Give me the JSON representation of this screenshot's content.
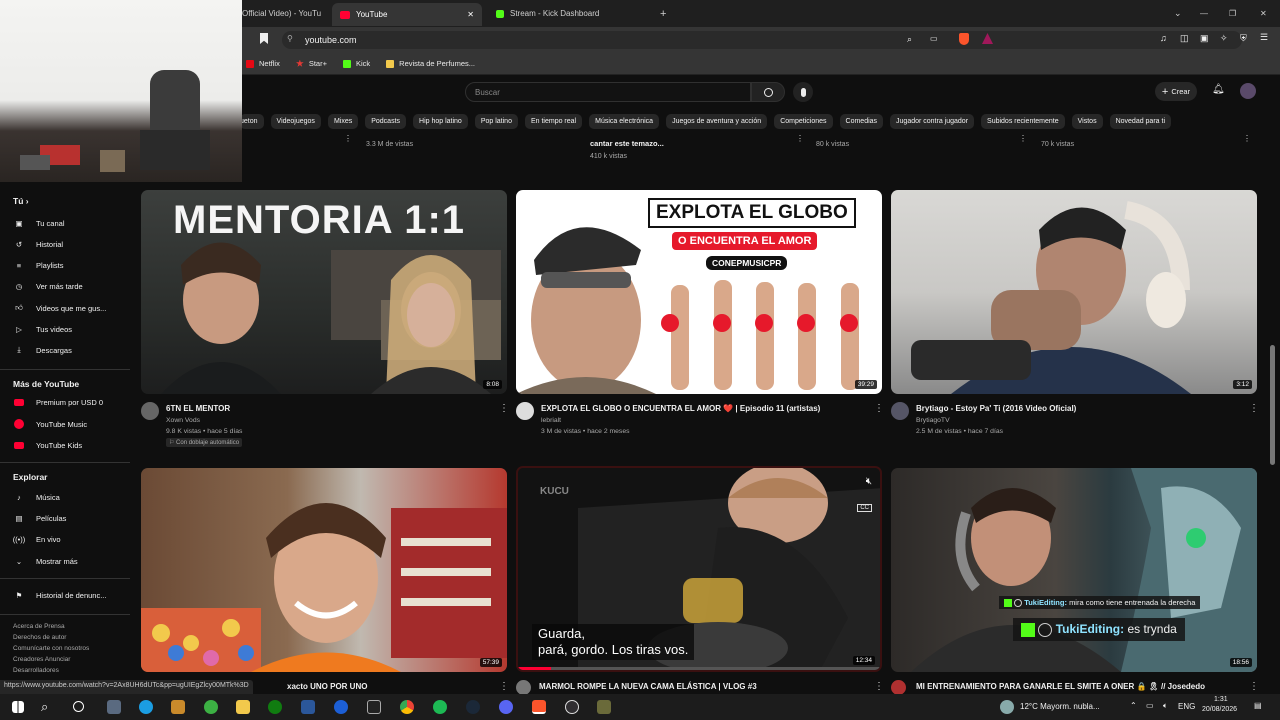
{
  "browser": {
    "tabs": [
      {
        "label": "Official Video) - YouTu",
        "active": false
      },
      {
        "label": "YouTube",
        "active": true
      },
      {
        "label": "Stream - Kick Dashboard",
        "active": false
      }
    ],
    "new_tab": "+",
    "address": "youtube.com",
    "bookmarks": [
      "Netflix",
      "Star+",
      "Kick",
      "Revista de Perfumes..."
    ]
  },
  "youtube": {
    "search_placeholder": "Buscar",
    "create_label": "Crear",
    "chips": [
      "ueton",
      "Videojuegos",
      "Mixes",
      "Podcasts",
      "Hip hop latino",
      "Pop latino",
      "En tiempo real",
      "Música electrónica",
      "Juegos de aventura y acción",
      "Competiciones",
      "Comedias",
      "Jugador contra jugador",
      "Subidos recientemente",
      "Vistos",
      "Novedad para ti"
    ],
    "sidebar": {
      "you_header": "Tú",
      "you_items": [
        "Tu canal",
        "Historial",
        "Playlists",
        "Ver más tarde",
        "Videos que me gus...",
        "Tus videos",
        "Descargas"
      ],
      "more_header": "Más de YouTube",
      "more_items": [
        "Premium por USD 0",
        "YouTube Music",
        "YouTube Kids"
      ],
      "explore_header": "Explorar",
      "explore_items": [
        "Música",
        "Películas",
        "En vivo",
        "Mostrar más"
      ],
      "report": "Historial de denunc...",
      "footer": [
        "Acerca de  Prensa",
        "Derechos de autor",
        "Comunícarte con nosotros",
        "Creadores  Anunciar",
        "Desarrolladores"
      ]
    },
    "previous_row": [
      {
        "meta": "3.3 M de vistas"
      },
      {
        "title": "cantar este temazo...",
        "meta": "410 k vistas"
      },
      {
        "meta": "80 k vistas"
      },
      {
        "meta": "70 k vistas"
      }
    ],
    "videos": [
      {
        "thumb_text": "MENTORIA 1:1",
        "duration": "8:08",
        "title": "6TN EL MENTOR",
        "channel": "Xown Vods",
        "meta": "9.8 K vistas • hace 5 días",
        "extra": "Con doblaje automático"
      },
      {
        "thumb_text": "EXPLOTA EL GLOBO",
        "thumb_sub": "O ENCUENTRA EL AMOR",
        "thumb_tag": "CONEPMUSICPR",
        "duration": "39:29",
        "title": "EXPLOTA EL GLOBO O ENCUENTRA EL AMOR ❤️ | Episodio 11 (artistas)",
        "channel": "lebrialt",
        "meta": "3 M de vistas • hace 2 meses"
      },
      {
        "duration": "3:12",
        "title": "Brytiago - Estoy Pa' Ti (2016 Video Oficial)",
        "channel": "BrytiagoTV",
        "meta": "2.5 M de vistas • hace 7 días"
      },
      {
        "duration": "57:39",
        "title": "xacto UNO POR UNO",
        "channel": "",
        "meta": ""
      },
      {
        "subtitle_line1": "Guarda,",
        "subtitle_line2": "pará, gordo. Los tiras vos.",
        "duration": "12:34",
        "title": "MARMOL ROMPE LA NUEVA CAMA ELÁSTICA | VLOG #3",
        "channel": "",
        "meta": ""
      },
      {
        "chat1_user": "TukiEditing:",
        "chat1_msg": "mira como tiene entrenada la derecha",
        "chat2_user": "TukiEditing:",
        "chat2_msg": "es trynda",
        "duration": "18:56",
        "title": "MI ENTRENAMIENTO PARA GANARLE EL SMITE A ONER 🔒 🎗 // Josededo",
        "channel": "",
        "meta": ""
      }
    ]
  },
  "status_url": "https://www.youtube.com/watch?v=2Ax8UH6dUTc&pp=ugUIEgZlcy00MTk%3D",
  "taskbar": {
    "weather": "12°C  Mayorm. nubla...",
    "lang": "ENG",
    "time": "1:31",
    "date": "20/08/2026"
  },
  "colors": {
    "bg": "#0f0f0f",
    "chip": "#272727",
    "accent": "#ff0033"
  }
}
